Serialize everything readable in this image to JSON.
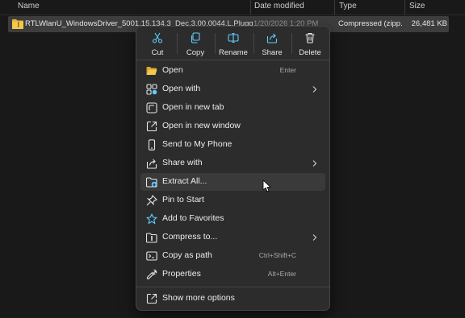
{
  "header": {
    "name": "Name",
    "date_modified": "Date modified",
    "type": "Type",
    "size": "Size"
  },
  "file": {
    "name": "RTLWlanU_WindowsDriver_5001.15.134.3_Dec.3.00.0044.L.Pluggable.zip",
    "date": "1/20/2026 1:20 PM",
    "type": "Compressed (zipp...",
    "size": "26,481 KB"
  },
  "quick_actions": [
    {
      "label": "Cut",
      "icon": "cut-icon"
    },
    {
      "label": "Copy",
      "icon": "copy-icon"
    },
    {
      "label": "Rename",
      "icon": "rename-icon"
    },
    {
      "label": "Share",
      "icon": "share-icon"
    },
    {
      "label": "Delete",
      "icon": "delete-icon"
    }
  ],
  "menu": {
    "items": [
      {
        "label": "Open",
        "shortcut": "Enter",
        "icon": "folder-open-icon"
      },
      {
        "label": "Open with",
        "submenu": true,
        "icon": "open-with-icon"
      },
      {
        "label": "Open in new tab",
        "icon": "new-tab-icon"
      },
      {
        "label": "Open in new window",
        "icon": "new-window-icon"
      },
      {
        "label": "Send to My Phone",
        "icon": "phone-icon"
      },
      {
        "label": "Share with",
        "submenu": true,
        "icon": "share-with-icon"
      },
      {
        "label": "Extract All...",
        "icon": "extract-icon",
        "highlighted": true
      },
      {
        "label": "Pin to Start",
        "icon": "pin-icon"
      },
      {
        "label": "Add to Favorites",
        "icon": "star-icon"
      },
      {
        "label": "Compress to...",
        "submenu": true,
        "icon": "compress-icon"
      },
      {
        "label": "Copy as path",
        "shortcut": "Ctrl+Shift+C",
        "icon": "copy-path-icon"
      },
      {
        "label": "Properties",
        "shortcut": "Alt+Enter",
        "icon": "properties-icon"
      }
    ],
    "more": {
      "label": "Show more options",
      "icon": "more-options-icon"
    }
  },
  "colors": {
    "background": "#191919",
    "menu": "#2c2c2c",
    "accent_blue": "#60cdff",
    "folder_yellow": "#e8b73a"
  }
}
